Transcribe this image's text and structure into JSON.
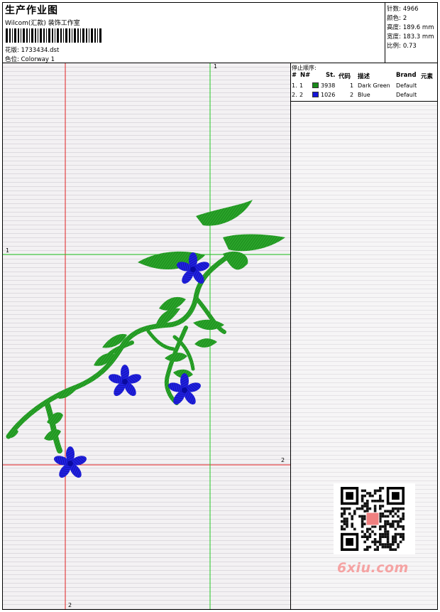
{
  "header": {
    "title": "生产作业图",
    "subtitle": "Wilcom(汇款) 装饰工作室",
    "design_label": "花版:",
    "design_value": "1733434.dst",
    "colorway_label": "色位:",
    "colorway_value": "Colorway 1"
  },
  "stats": {
    "stitches_label": "针数:",
    "stitches_value": "4966",
    "colors_label": "颜色:",
    "colors_value": "2",
    "height_label": "高度:",
    "height_value": "189.6 mm",
    "width_label": "宽度:",
    "width_value": "183.3 mm",
    "ratio_label": "比例:",
    "ratio_value": "0.73"
  },
  "stop_sequence": {
    "label": "停止顺序:",
    "columns": [
      "#",
      "N#",
      "St.",
      "代码",
      "描述",
      "Brand",
      "元素"
    ],
    "rows": [
      {
        "num": "1.",
        "n": "1",
        "st": "3938",
        "code": "1",
        "desc": "Dark Green",
        "brand": "Default",
        "color": "#1a8a1a"
      },
      {
        "num": "2.",
        "n": "2",
        "st": "1026",
        "code": "2",
        "desc": "Blue",
        "brand": "Default",
        "color": "#1515d8"
      }
    ]
  },
  "guides": {
    "green_top": "1",
    "green_left": "1",
    "red_right": "2",
    "red_bottom": "2"
  },
  "colors": {
    "green": "#1f9a1f",
    "blue": "#1a1ad8",
    "guide_green": "#22c622",
    "guide_red": "#e02020"
  },
  "watermark": "6xiu.com"
}
